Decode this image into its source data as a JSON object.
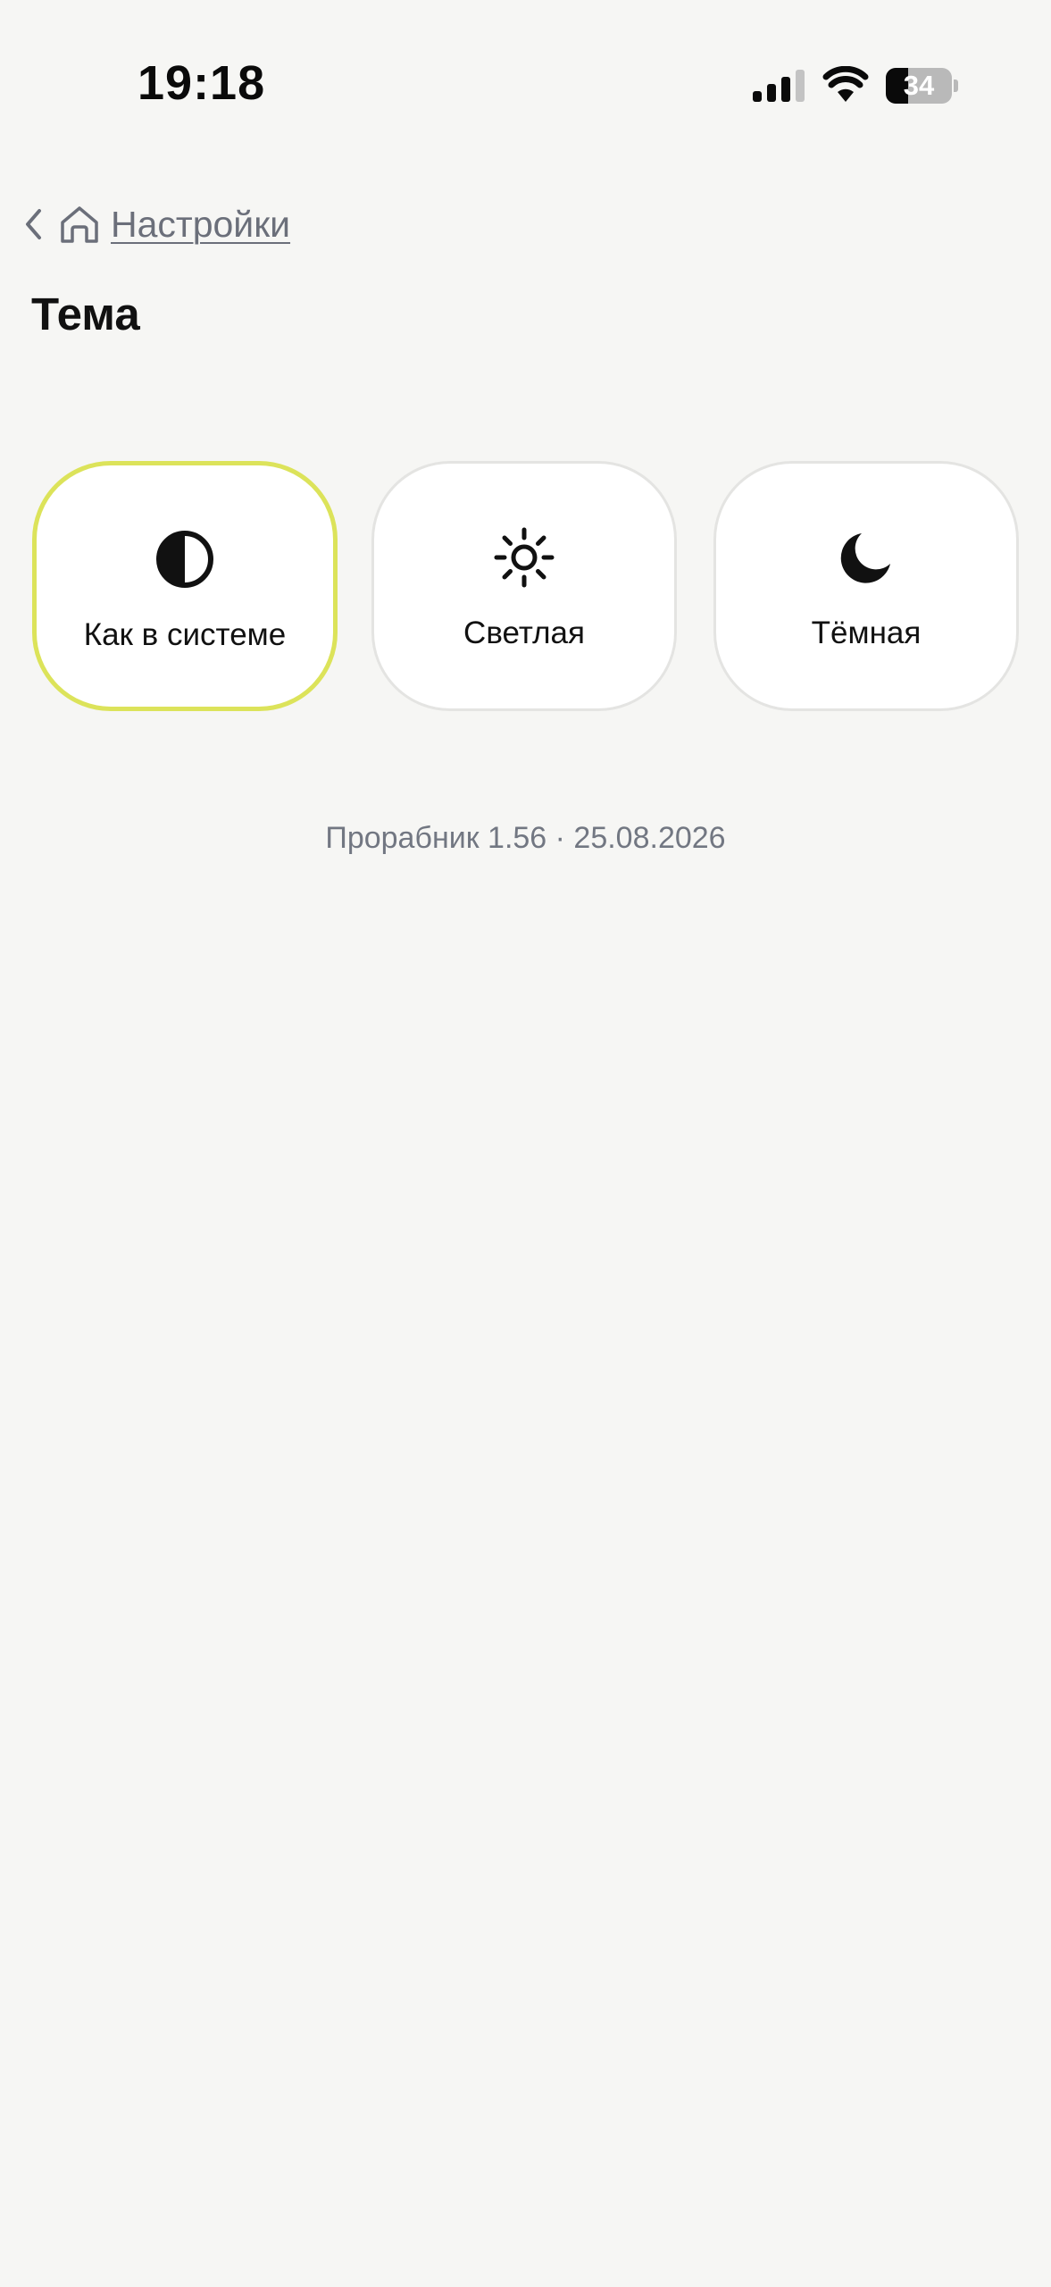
{
  "status_bar": {
    "time": "19:18",
    "battery_percent": 34,
    "battery_text": "34",
    "signal_icon": "cellular-signal-icon",
    "wifi_icon": "wifi-icon"
  },
  "breadcrumb": {
    "back_icon": "chevron-left-icon",
    "home_icon": "home-icon",
    "label": "Настройки"
  },
  "page": {
    "title": "Тема"
  },
  "theme_options": [
    {
      "label": "Как в системе",
      "icon": "half-circle-contrast-icon",
      "selected": true
    },
    {
      "label": "Светлая",
      "icon": "sun-icon",
      "selected": false
    },
    {
      "label": "Тёмная",
      "icon": "moon-icon",
      "selected": false
    }
  ],
  "footer": {
    "version": "Прорабник 1.56 · 25.08.2026"
  },
  "colors": {
    "background": "#f6f6f4",
    "card": "#ffffff",
    "selected_border": "#dce35a",
    "link": "#6b6f7a",
    "muted_text": "#727782"
  }
}
